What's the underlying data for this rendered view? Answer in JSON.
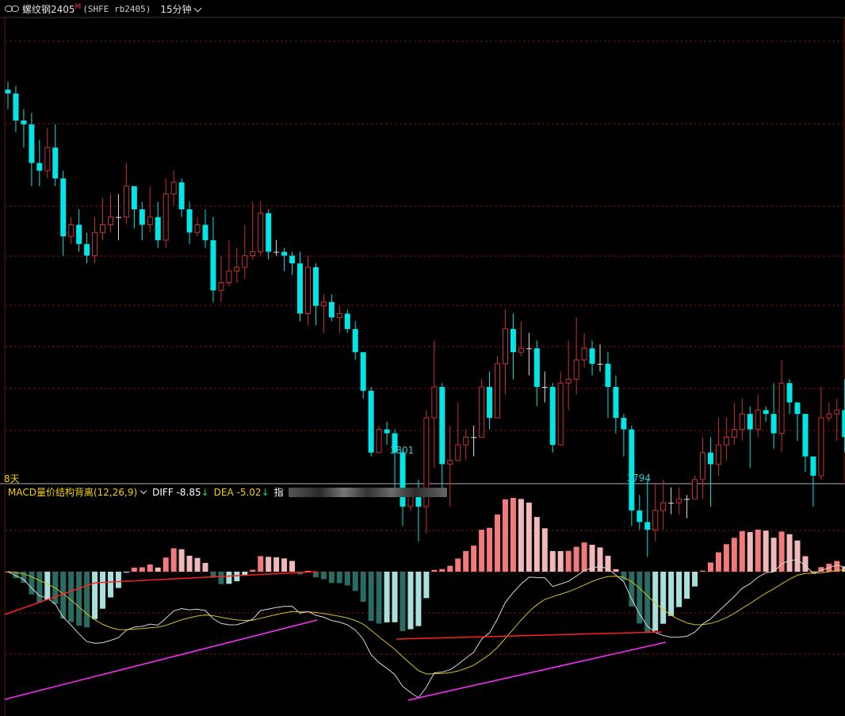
{
  "header": {
    "instrument_name": "螺纹钢2405",
    "superscript": "M",
    "code": "(SHFE rb2405)",
    "period": "15分钟"
  },
  "main_panel": {
    "period_count_label": "8天",
    "low_labels": [
      "3801",
      "3794"
    ]
  },
  "macd_panel": {
    "indicator_name": "MACD量价结构背离(12,26,9)",
    "diff_text": "DIFF -8.85",
    "diff_arrow": "↓",
    "dea_text": "DEA -5.02",
    "dea_arrow": "↓",
    "extra_text": "指"
  },
  "colors": {
    "up_candle": "#c83232",
    "down_candle": "#00e5e5",
    "neutral_candle": "#e0e0e0",
    "macd_pos_strong": "#f27a7a",
    "macd_pos_weak": "#f0b8b8",
    "macd_neg_strong": "#2a6b62",
    "macd_neg_weak": "#a8e0dc",
    "diff_line": "#d8d8d8",
    "dea_line": "#d4c21c",
    "divergence_red": "#ff2020",
    "divergence_magenta": "#ff2aff",
    "low_label": "#36c8d6",
    "grid": "#7a1010"
  },
  "chart_data": {
    "type": "candlestick",
    "price_range": [
      3785,
      3900
    ],
    "candles": [
      [
        3885,
        3884,
        3887,
        3880
      ],
      [
        3884,
        3877,
        3886,
        3874
      ],
      [
        3877,
        3876,
        3880,
        3870
      ],
      [
        3876,
        3866,
        3879,
        3860
      ],
      [
        3866,
        3864,
        3872,
        3860
      ],
      [
        3864,
        3870,
        3875,
        3862
      ],
      [
        3870,
        3862,
        3876,
        3860
      ],
      [
        3862,
        3847,
        3864,
        3842
      ],
      [
        3847,
        3850,
        3852,
        3845
      ],
      [
        3850,
        3845,
        3854,
        3843
      ],
      [
        3845,
        3842,
        3848,
        3840
      ],
      [
        3842,
        3848,
        3852,
        3840
      ],
      [
        3848,
        3850,
        3857,
        3846
      ],
      [
        3850,
        3852,
        3858,
        3848
      ],
      [
        3852,
        3852,
        3858,
        3846
      ],
      [
        3852,
        3860,
        3866,
        3850
      ],
      [
        3860,
        3854,
        3860,
        3849
      ],
      [
        3854,
        3850,
        3856,
        3846
      ],
      [
        3850,
        3852,
        3860,
        3848
      ],
      [
        3852,
        3846,
        3856,
        3844
      ],
      [
        3846,
        3858,
        3862,
        3844
      ],
      [
        3858,
        3861,
        3864,
        3855
      ],
      [
        3861,
        3854,
        3862,
        3852
      ],
      [
        3854,
        3848,
        3856,
        3845
      ],
      [
        3848,
        3850,
        3852,
        3847
      ],
      [
        3850,
        3846,
        3854,
        3844
      ],
      [
        3846,
        3833,
        3852,
        3830
      ],
      [
        3833,
        3835,
        3842,
        3830
      ],
      [
        3835,
        3838,
        3846,
        3834
      ],
      [
        3838,
        3839,
        3844,
        3835
      ],
      [
        3839,
        3842,
        3850,
        3836
      ],
      [
        3842,
        3843,
        3856,
        3841
      ],
      [
        3843,
        3853,
        3856,
        3842
      ],
      [
        3853,
        3843,
        3854,
        3841
      ],
      [
        3843,
        3843,
        3846,
        3842
      ],
      [
        3843,
        3842,
        3844,
        3838
      ],
      [
        3842,
        3840,
        3843,
        3837
      ],
      [
        3840,
        3827,
        3843,
        3825
      ],
      [
        3827,
        3839,
        3842,
        3824
      ],
      [
        3839,
        3829,
        3840,
        3824
      ],
      [
        3829,
        3830,
        3832,
        3822
      ],
      [
        3830,
        3826,
        3832,
        3825
      ],
      [
        3826,
        3827,
        3829,
        3822
      ],
      [
        3827,
        3823,
        3828,
        3822
      ],
      [
        3823,
        3817,
        3825,
        3815
      ],
      [
        3817,
        3807,
        3817,
        3805
      ],
      [
        3807,
        3791,
        3808,
        3790
      ],
      [
        3791,
        3797,
        3798,
        3791
      ],
      [
        3797,
        3796,
        3799,
        3793
      ],
      [
        3796,
        3791,
        3797,
        3781
      ],
      [
        3791,
        3777,
        3792,
        3772
      ],
      [
        3777,
        3780,
        3781,
        3776
      ],
      [
        3780,
        3777,
        3784,
        3768
      ],
      [
        3777,
        3800,
        3802,
        3770
      ],
      [
        3800,
        3808,
        3820,
        3787
      ],
      [
        3808,
        3788,
        3809,
        3781
      ],
      [
        3788,
        3789,
        3798,
        3777
      ],
      [
        3789,
        3793,
        3804,
        3790
      ],
      [
        3793,
        3795,
        3797,
        3789
      ],
      [
        3795,
        3795,
        3798,
        3790
      ],
      [
        3795,
        3808,
        3810,
        3798
      ],
      [
        3808,
        3800,
        3812,
        3797
      ],
      [
        3800,
        3814,
        3816,
        3808
      ],
      [
        3814,
        3823,
        3828,
        3806
      ],
      [
        3823,
        3817,
        3827,
        3810
      ],
      [
        3817,
        3818,
        3825,
        3816
      ],
      [
        3818,
        3818,
        3822,
        3811
      ],
      [
        3818,
        3808,
        3820,
        3803
      ],
      [
        3808,
        3808,
        3812,
        3804
      ],
      [
        3808,
        3793,
        3809,
        3791
      ],
      [
        3793,
        3809,
        3812,
        3793
      ],
      [
        3809,
        3810,
        3820,
        3802
      ],
      [
        3810,
        3815,
        3826,
        3806
      ],
      [
        3815,
        3818,
        3822,
        3813
      ],
      [
        3818,
        3814,
        3820,
        3811
      ],
      [
        3814,
        3814,
        3819,
        3812
      ],
      [
        3814,
        3808,
        3817,
        3800
      ],
      [
        3808,
        3800,
        3811,
        3796
      ],
      [
        3800,
        3797,
        3801,
        3790
      ],
      [
        3797,
        3776,
        3798,
        3772
      ],
      [
        3776,
        3773,
        3780,
        3771
      ],
      [
        3773,
        3771,
        3784,
        3764
      ],
      [
        3771,
        3776,
        3783,
        3768
      ],
      [
        3776,
        3778,
        3784,
        3771
      ],
      [
        3778,
        3778,
        3782,
        3775
      ],
      [
        3778,
        3779,
        3782,
        3775
      ],
      [
        3779,
        3779,
        3780,
        3774
      ],
      [
        3779,
        3784,
        3785,
        3780
      ],
      [
        3784,
        3791,
        3795,
        3779
      ],
      [
        3791,
        3788,
        3795,
        3777
      ],
      [
        3788,
        3793,
        3800,
        3785
      ],
      [
        3793,
        3795,
        3800,
        3789
      ],
      [
        3795,
        3797,
        3804,
        3793
      ],
      [
        3797,
        3801,
        3805,
        3794
      ],
      [
        3801,
        3797,
        3803,
        3787
      ],
      [
        3797,
        3802,
        3806,
        3795
      ],
      [
        3802,
        3801,
        3803,
        3799
      ],
      [
        3801,
        3796,
        3809,
        3792
      ],
      [
        3796,
        3809,
        3815,
        3791
      ],
      [
        3809,
        3804,
        3810,
        3801
      ],
      [
        3804,
        3801,
        3804,
        3794
      ],
      [
        3801,
        3790,
        3801,
        3786
      ],
      [
        3790,
        3785,
        3788,
        3777
      ],
      [
        3785,
        3800,
        3808,
        3784
      ],
      [
        3800,
        3801,
        3804,
        3799
      ],
      [
        3801,
        3802,
        3805,
        3794
      ],
      [
        3802,
        3795,
        3810,
        3791
      ],
      [
        3795,
        3798,
        3800,
        3792
      ],
      [
        3798,
        3801,
        3810,
        3797
      ]
    ],
    "low_points": [
      3801,
      3794
    ]
  }
}
